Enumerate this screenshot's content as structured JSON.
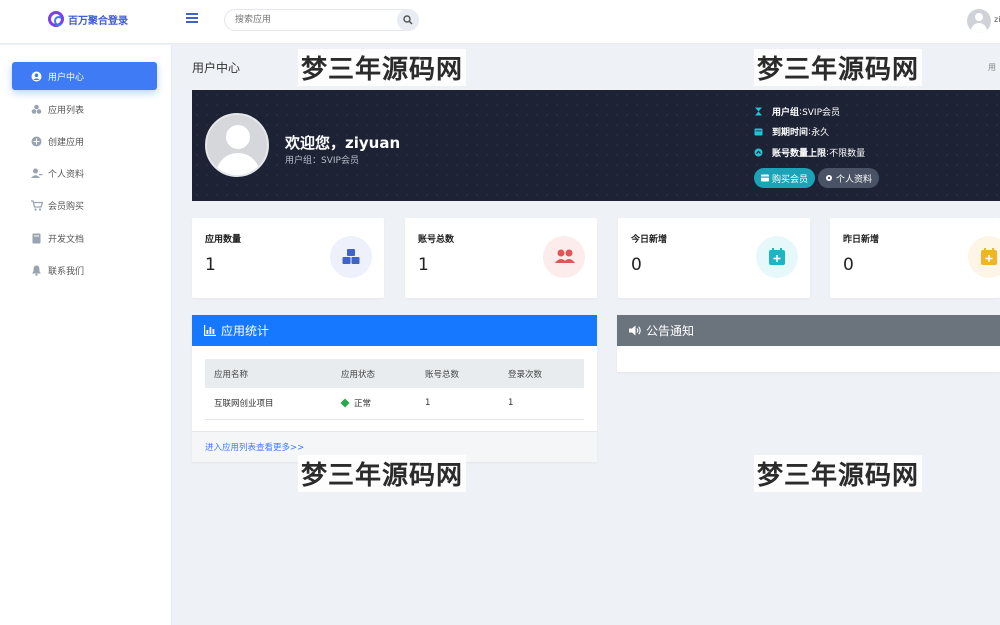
{
  "brand": {
    "name": "百万聚合登录",
    "logo_icon": "brand-logo-icon"
  },
  "search": {
    "placeholder": "搜索应用"
  },
  "user": {
    "name": "zi"
  },
  "sidebar": {
    "items": [
      {
        "label": "用户中心",
        "icon": "user-circle-icon",
        "active": true
      },
      {
        "label": "应用列表",
        "icon": "apps-icon"
      },
      {
        "label": "创建应用",
        "icon": "plus-circle-icon"
      },
      {
        "label": "个人资料",
        "icon": "user-edit-icon"
      },
      {
        "label": "会员购买",
        "icon": "cart-icon"
      },
      {
        "label": "开发文档",
        "icon": "book-icon"
      },
      {
        "label": "联系我们",
        "icon": "bell-icon"
      }
    ]
  },
  "page": {
    "title": "用户中心",
    "breadcrumb": "用"
  },
  "watermark": "梦三年源码网",
  "banner": {
    "welcome": "欢迎您，ziyuan",
    "subtitle": "用户组：SVIP会员",
    "info": [
      {
        "label": "用户组",
        "sep": " : ",
        "value": "SVIP会员"
      },
      {
        "label": "到期时间",
        "sep": " : ",
        "value": "永久"
      },
      {
        "label": "账号数量上限",
        "sep": " : ",
        "value": "不限数量"
      }
    ],
    "buy_button": "购买会员",
    "profile_button": "个人资料"
  },
  "stats": [
    {
      "label": "应用数量",
      "value": "1",
      "icon": "cubes-icon",
      "color": "#3f63c8",
      "bg": "#eef0fb"
    },
    {
      "label": "账号总数",
      "value": "1",
      "icon": "users-icon",
      "color": "#e05555",
      "bg": "#fdecec"
    },
    {
      "label": "今日新增",
      "value": "0",
      "icon": "calendar-plus-icon",
      "color": "#20b3c4",
      "bg": "#e6f8fa"
    },
    {
      "label": "昨日新增",
      "value": "0",
      "icon": "calendar-plus-icon",
      "color": "#f0b429",
      "bg": "#fdf6e6"
    }
  ],
  "app_panel": {
    "title": "应用统计",
    "header_color": "#1677ff",
    "columns": [
      "应用名称",
      "应用状态",
      "账号总数",
      "登录次数"
    ],
    "rows": [
      {
        "name": "互联网创业项目",
        "status": "正常",
        "accounts": "1",
        "logins": "1"
      }
    ],
    "footer_link": "进入应用列表查看更多>>"
  },
  "notice_panel": {
    "title": "公告通知",
    "header_color": "#6b737c"
  }
}
